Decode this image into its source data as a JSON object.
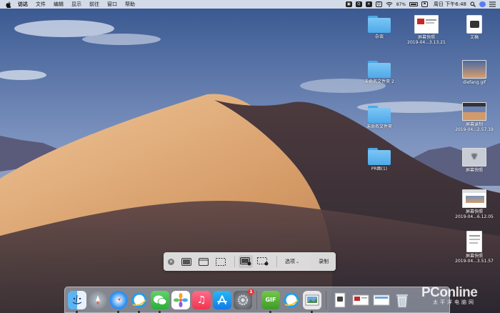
{
  "menubar": {
    "app_name": "访达",
    "items": [
      "文件",
      "编辑",
      "显示",
      "前往",
      "窗口",
      "帮助"
    ],
    "battery_percent": "87%",
    "clock": "周日 下午6:48"
  },
  "desktop": {
    "folders": [
      {
        "label": "杂谈"
      },
      {
        "label": "未命名文件夹 2"
      },
      {
        "label": "未命名文件夹"
      },
      {
        "label": "PR图(1)"
      }
    ],
    "files": [
      {
        "label": "屏幕快照",
        "sublabel": "2019-04...3.13.21"
      },
      {
        "label": "文稿",
        "sublabel": ""
      },
      {
        "label": "diefang.gif",
        "sublabel": ""
      },
      {
        "label": "屏幕录制",
        "sublabel": "2019-04...2.57.19"
      },
      {
        "label": "屏幕快照",
        "sublabel": ""
      },
      {
        "label": "屏幕快照",
        "sublabel": "2019-04...6.12.05"
      },
      {
        "label": "屏幕快照",
        "sublabel": "2019-04...3.51.57"
      }
    ]
  },
  "capture_toolbar": {
    "close_icon": "close-x",
    "options_label": "选项",
    "record_label": "录制"
  },
  "dock": {
    "apps": [
      "finder",
      "launchpad",
      "safari",
      "qq-browser",
      "wechat",
      "photos",
      "music",
      "app-store",
      "system-preferences"
    ],
    "system_prefs_badge": "1",
    "gif_label": "GIF"
  },
  "watermark": {
    "brand": "PConline",
    "sub": "太平洋电脑网"
  },
  "colors": {
    "sky_top": "#3e5a93",
    "sky_bottom": "#b9c4dd",
    "dune_light": "#e5b586",
    "dune_shadow": "#5a3c35",
    "folder_blue": "#5eb3ee"
  }
}
